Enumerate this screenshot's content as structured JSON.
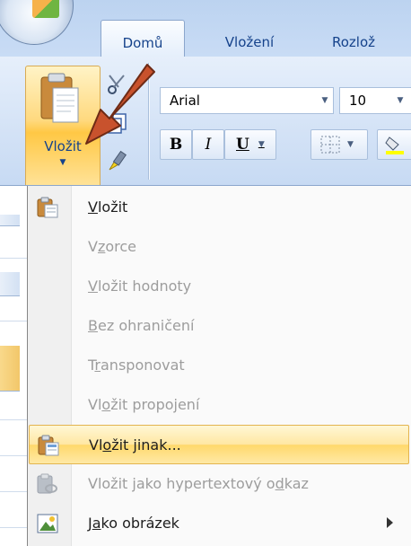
{
  "tabs": [
    {
      "label": "Domů",
      "active": true
    },
    {
      "label": "Vložení",
      "active": false
    },
    {
      "label": "Rozlož",
      "active": false
    }
  ],
  "clipboard": {
    "paste_label": "Vložit"
  },
  "font": {
    "name": "Arial",
    "size": "10",
    "bold_label": "B",
    "italic_label": "I",
    "underline_label": "U"
  },
  "menu": {
    "items": [
      {
        "pre": "",
        "u": "V",
        "post": "ložit",
        "enabled": true,
        "icon": "paste-icon"
      },
      {
        "pre": "V",
        "u": "z",
        "post": "orce",
        "enabled": false,
        "icon": ""
      },
      {
        "pre": "",
        "u": "V",
        "post": "ložit hodnoty",
        "enabled": false,
        "icon": ""
      },
      {
        "pre": "",
        "u": "B",
        "post": "ez ohraničení",
        "enabled": false,
        "icon": ""
      },
      {
        "pre": "T",
        "u": "r",
        "post": "ansponovat",
        "enabled": false,
        "icon": ""
      },
      {
        "pre": "Vl",
        "u": "o",
        "post": "žit propojení",
        "enabled": false,
        "icon": ""
      },
      {
        "pre": "Vl",
        "u": "o",
        "post": "žit jinak...",
        "enabled": true,
        "icon": "paste-special-icon",
        "highlighted": true
      },
      {
        "pre": "Vložit jako hypertextový o",
        "u": "d",
        "post": "kaz",
        "enabled": false,
        "icon": "paste-hyperlink-icon"
      },
      {
        "pre": "J",
        "u": "a",
        "post": "ko obrázek",
        "enabled": true,
        "icon": "picture-icon",
        "submenu": true
      }
    ]
  },
  "colors": {
    "menu_hover": "#ffe7a2",
    "arrow": "#c8522d",
    "ribbon_text": "#15428b"
  }
}
